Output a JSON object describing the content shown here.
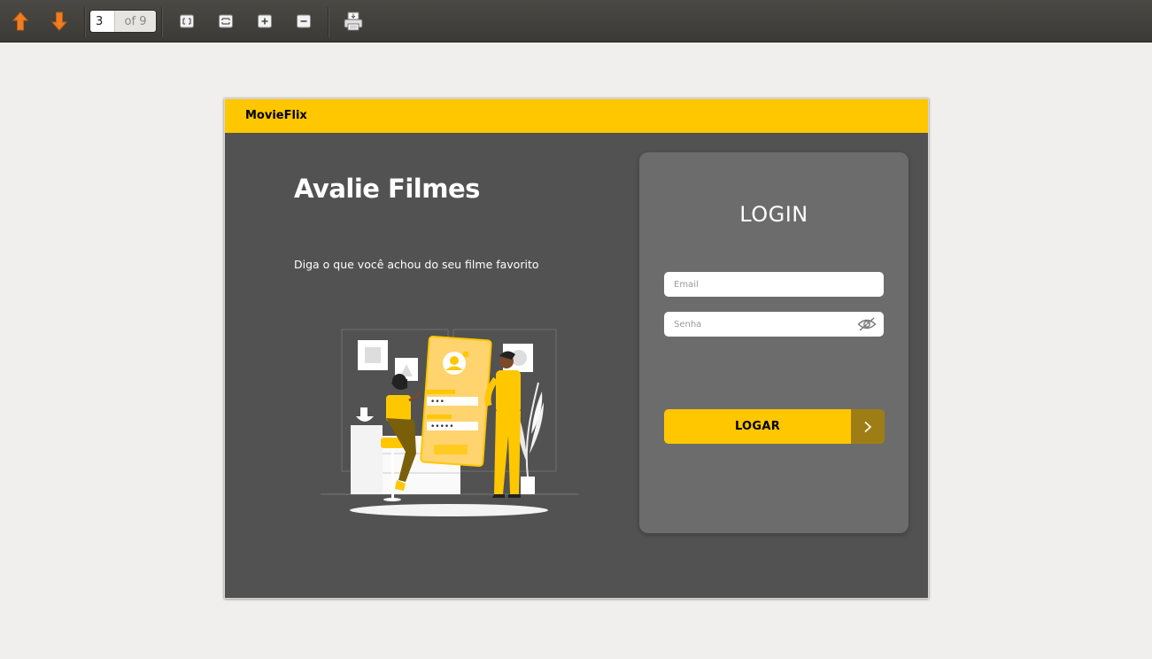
{
  "viewer": {
    "page_current": "3",
    "page_total_label": "of 9",
    "icons": [
      "arrow-up-icon",
      "arrow-down-icon",
      "fit-page-icon",
      "fit-width-icon",
      "zoom-in-icon",
      "zoom-out-icon",
      "print-icon"
    ],
    "accent_color": "#f07d22"
  },
  "app": {
    "brand": "MovieFlix",
    "brand_color": "#ffc700",
    "background_color": "#525252"
  },
  "hero": {
    "title": "Avalie Filmes",
    "subtitle": "Diga o que você achou do seu filme favorito"
  },
  "login": {
    "title": "LOGIN",
    "email_placeholder": "Email",
    "email_value": "",
    "password_placeholder": "Senha",
    "password_value": "",
    "submit_label": "LOGAR",
    "submit_color": "#ffc700",
    "submit_arrow_color": "#9e7e14"
  }
}
